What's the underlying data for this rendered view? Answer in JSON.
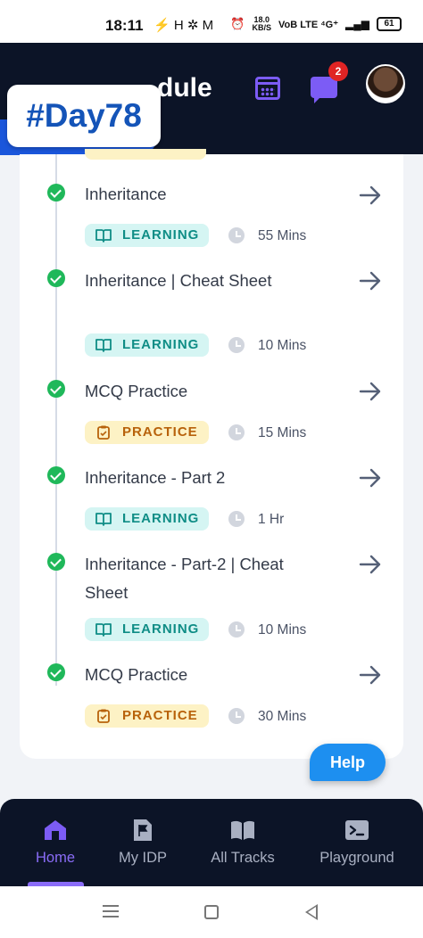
{
  "status_bar": {
    "time": "18:11",
    "indicators": "⚡ H ✲ M",
    "speed_top": "18.0",
    "speed_bottom": "KB/S",
    "network": "VoB LTE ⁴G⁺",
    "battery": "61"
  },
  "header": {
    "title_partial": "dule",
    "notification_count": "2"
  },
  "day_badge": "#Day78",
  "steps": [
    {
      "title": "Inheritance",
      "tag": "LEARNING",
      "duration": "55 Mins",
      "completed": true
    },
    {
      "title": "Inheritance | Cheat Sheet",
      "tag": "LEARNING",
      "duration": "10 Mins",
      "completed": true
    },
    {
      "title": "MCQ Practice",
      "tag": "PRACTICE",
      "duration": "15 Mins",
      "completed": true
    },
    {
      "title": "Inheritance - Part 2",
      "tag": "LEARNING",
      "duration": "1 Hr",
      "completed": true
    },
    {
      "title": "Inheritance - Part-2 | Cheat Sheet",
      "tag": "LEARNING",
      "duration": "10 Mins",
      "completed": true
    },
    {
      "title": "MCQ Practice",
      "tag": "PRACTICE",
      "duration": "30 Mins",
      "completed": true
    }
  ],
  "help_label": "Help",
  "bottom_nav": [
    {
      "label": "Home",
      "icon": "home-icon",
      "active": true
    },
    {
      "label": "My IDP",
      "icon": "flag-document-icon",
      "active": false
    },
    {
      "label": "All Tracks",
      "icon": "open-book-icon",
      "active": false
    },
    {
      "label": "Playground",
      "icon": "terminal-icon",
      "active": false
    }
  ],
  "colors": {
    "header_bg": "#0c1427",
    "accent_purple": "#8a6cf7",
    "learning_bg": "#d5f5f3",
    "learning_text": "#0f8d86",
    "practice_bg": "#fdf2c5",
    "practice_text": "#b8620b",
    "check_green": "#1fb85a",
    "help_blue": "#1d8ff0",
    "badge_blue": "#1454b8"
  }
}
